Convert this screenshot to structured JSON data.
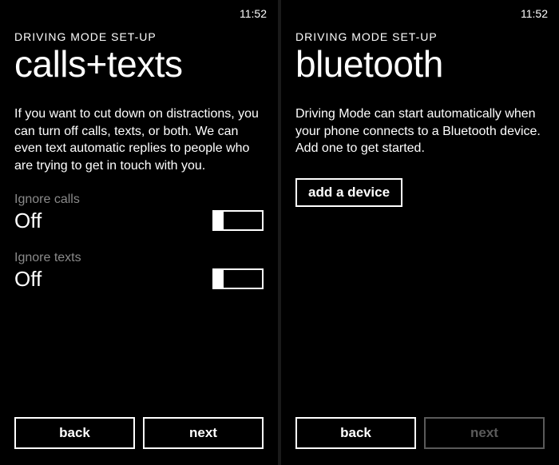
{
  "left": {
    "status": {
      "time": "11:52"
    },
    "breadcrumb": "DRIVING MODE SET-UP",
    "title": "calls+texts",
    "description": "If you want to cut down on distractions, you can turn off calls, texts, or both. We can even text automatic replies to people who are trying to get in touch with you.",
    "toggles": {
      "ignore_calls": {
        "label": "Ignore calls",
        "value": "Off"
      },
      "ignore_texts": {
        "label": "Ignore texts",
        "value": "Off"
      }
    },
    "nav": {
      "back": "back",
      "next": "next"
    }
  },
  "right": {
    "status": {
      "time": "11:52"
    },
    "breadcrumb": "DRIVING MODE SET-UP",
    "title": "bluetooth",
    "description": "Driving Mode can start automatically when your phone connects to a Bluetooth device. Add one to get started.",
    "add_device": "add a device",
    "nav": {
      "back": "back",
      "next": "next"
    }
  }
}
